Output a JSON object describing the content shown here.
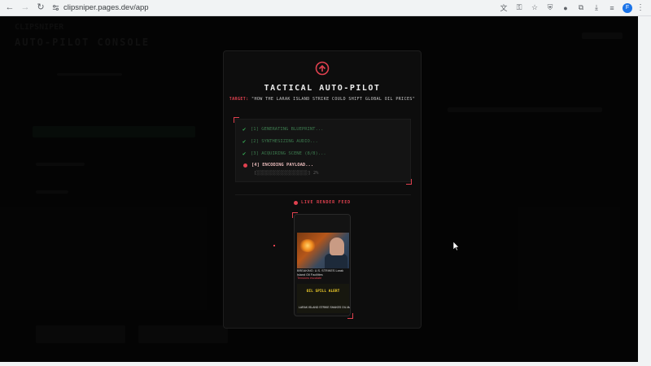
{
  "browser": {
    "url": "clipsniper.pages.dev/app",
    "profile_initial": "F"
  },
  "page": {
    "subtitle": "CLIPSNIPER",
    "title": "AUTO-PILOT CONSOLE"
  },
  "modal": {
    "title": "TACTICAL AUTO-PILOT",
    "target_label": "TARGET:",
    "target_value": "\"HOW THE LARAK ISLAND STRIKE COULD SHIFT GLOBAL OIL PRICES\"",
    "accent_color": "#e0414f",
    "log": [
      {
        "text": "[1] GENERATING BLUEPRINT...",
        "status": "done"
      },
      {
        "text": "[2] SYNTHESIZING AUDIO...",
        "status": "done"
      },
      {
        "text": "[3] ACQUIRING SCENE (8/8)...",
        "status": "done"
      },
      {
        "text": "[4] ENCODING PAYLOAD...",
        "status": "active"
      }
    ],
    "progress_text": "[░░░░░░░░░░░░░░░░░░░] 2%",
    "progress_percent": 2,
    "live_feed_label": "LIVE RENDER FEED"
  },
  "preview": {
    "caption": "BREAKING: U.S. STRIKES Larak Island Oil Facilities",
    "caption_sub": "Tensions escalate",
    "card_title": "OIL SPILL ALERT",
    "card_text": "LARAK ISLAND STRIKE SHAKES OIL MARKETS"
  }
}
